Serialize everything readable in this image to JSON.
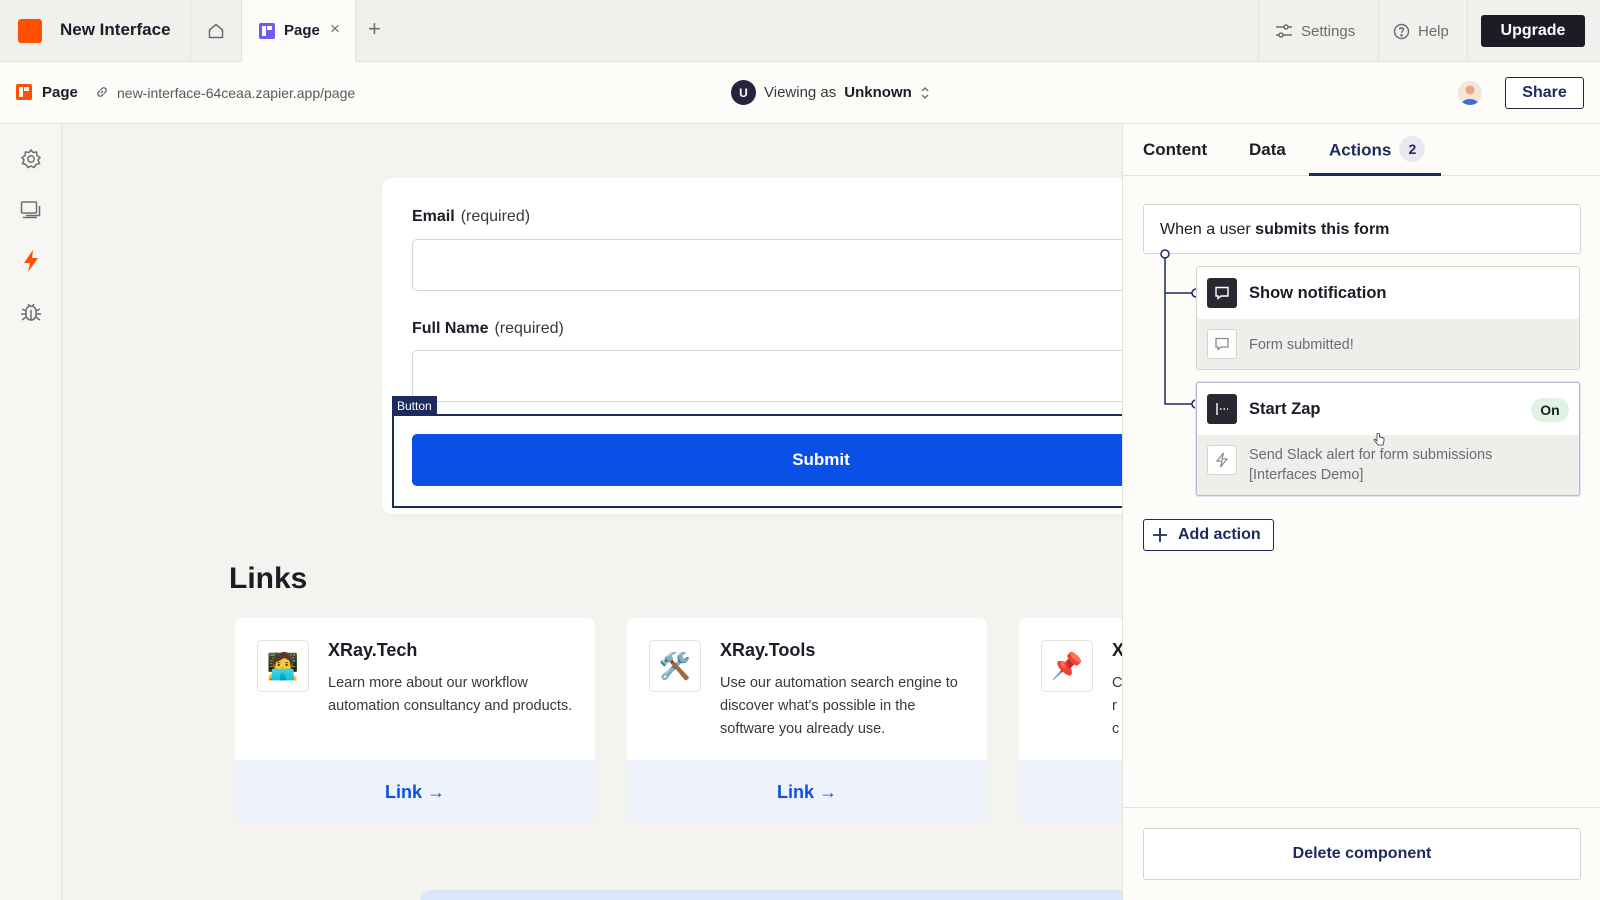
{
  "app": {
    "title": "New Interface"
  },
  "tabs": [
    {
      "label": "Page",
      "close": "×"
    }
  ],
  "add_tab": "+",
  "header": {
    "settings_label": "Settings",
    "help_label": "Help",
    "upgrade_label": "Upgrade"
  },
  "subbar": {
    "page_label": "Page",
    "url": "new-interface-64ceaa.zapier.app/page",
    "viewing_prefix": "Viewing as",
    "viewing_user": "Unknown",
    "viewing_initial": "U",
    "share_label": "Share"
  },
  "form": {
    "fields": [
      {
        "label": "Email",
        "hint": "(required)",
        "value": ""
      },
      {
        "label": "Full Name",
        "hint": "(required)",
        "value": ""
      }
    ],
    "selection_badge": "Button",
    "submit_label": "Submit"
  },
  "links": {
    "heading": "Links",
    "cards": [
      {
        "icon": "🧑‍💻",
        "title": "XRay.Tech",
        "description": "Learn more about our workflow automation consultancy and products.",
        "link_label": "Link →"
      },
      {
        "icon": "🛠️",
        "title": "XRay.Tools",
        "description": "Use our automation search engine to discover what's possible in the software you already use.",
        "link_label": "Link →"
      },
      {
        "icon": "📌",
        "title": "X",
        "description": "C r c",
        "link_label": ""
      }
    ]
  },
  "panel": {
    "tabs": [
      {
        "label": "Content"
      },
      {
        "label": "Data"
      },
      {
        "label": "Actions",
        "count": "2"
      }
    ],
    "active_tab": "Actions",
    "trigger": {
      "prefix": "When a user",
      "strong": "submits this form"
    },
    "actions": [
      {
        "title": "Show notification",
        "detail": "Form submitted!",
        "status": ""
      },
      {
        "title": "Start Zap",
        "detail": "Send Slack alert for form submissions [Interfaces Demo]",
        "status": "On"
      }
    ],
    "add_action_label": "Add action",
    "delete_label": "Delete component"
  },
  "colors": {
    "brand": "#ff4f00",
    "primary": "#0a4fe6",
    "navy": "#1c2a5e",
    "on_badge": "#dff2e4"
  }
}
